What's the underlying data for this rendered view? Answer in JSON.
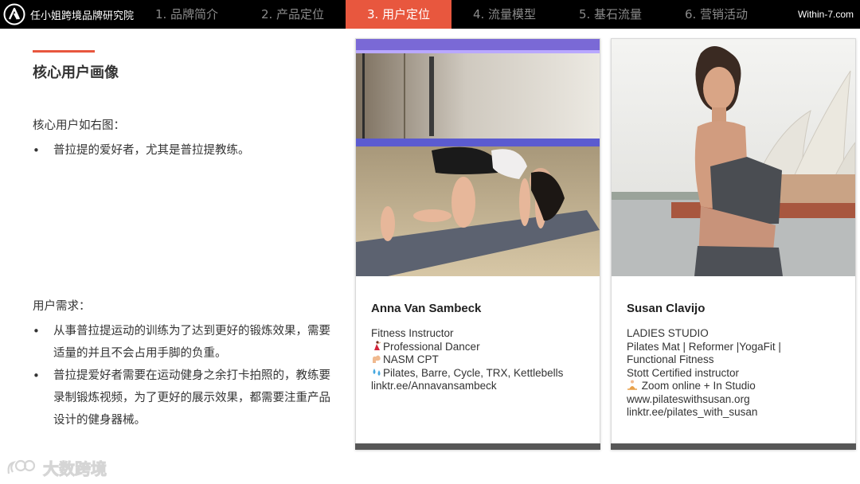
{
  "header": {
    "brand_name": "任小姐跨境品牌研究院",
    "site": "Within-7.com",
    "tabs": [
      {
        "label": "1. 品牌简介",
        "active": false
      },
      {
        "label": "2. 产品定位",
        "active": false
      },
      {
        "label": "3. 用户定位",
        "active": true
      },
      {
        "label": "4. 流量模型",
        "active": false
      },
      {
        "label": "5. 基石流量",
        "active": false
      },
      {
        "label": "6. 营销活动",
        "active": false
      }
    ]
  },
  "section": {
    "title": "核心用户画像",
    "core_users": {
      "heading": "核心用户如右图：",
      "items": [
        "普拉提的爱好者，尤其是普拉提教练。"
      ]
    },
    "needs": {
      "heading": "用户需求：",
      "items": [
        "从事普拉提运动的训练为了达到更好的锻炼效果，需要适量的并且不会占用手脚的负重。",
        "普拉提爱好者需要在运动健身之余打卡拍照的，教练要录制锻炼视频，为了更好的展示效果，都需要注重产品设计的健身器械。"
      ]
    }
  },
  "cards": [
    {
      "name": "Anna Van Sambeck",
      "lines": [
        {
          "icon": "",
          "text": "Fitness Instructor"
        },
        {
          "icon": "dancer-icon",
          "text": "Professional Dancer"
        },
        {
          "icon": "flexed-bicep-icon",
          "text": "NASM CPT"
        },
        {
          "icon": "sweat-drops-icon",
          "text": "Pilates, Barre, Cycle, TRX, Kettlebells"
        },
        {
          "icon": "",
          "text": "linktr.ee/Annavansambeck"
        }
      ]
    },
    {
      "name": "Susan Clavijo",
      "lines": [
        {
          "icon": "",
          "text": "LADIES STUDIO"
        },
        {
          "icon": "",
          "text": "Pilates Mat | Reformer |YogaFit |"
        },
        {
          "icon": "",
          "text": "Functional Fitness"
        },
        {
          "icon": "",
          "text": "Stott Certified instructor"
        },
        {
          "icon": "meditation-icon",
          "text": "Zoom online + In Studio"
        },
        {
          "icon": "",
          "text": "www.pilateswithsusan.org"
        },
        {
          "icon": "",
          "text": "linktr.ee/pilates_with_susan"
        }
      ]
    }
  ],
  "watermark": {
    "text": "大数跨境"
  },
  "colors": {
    "accent": "#e8573e",
    "topbar": "#000000",
    "card_footer": "#575757"
  }
}
